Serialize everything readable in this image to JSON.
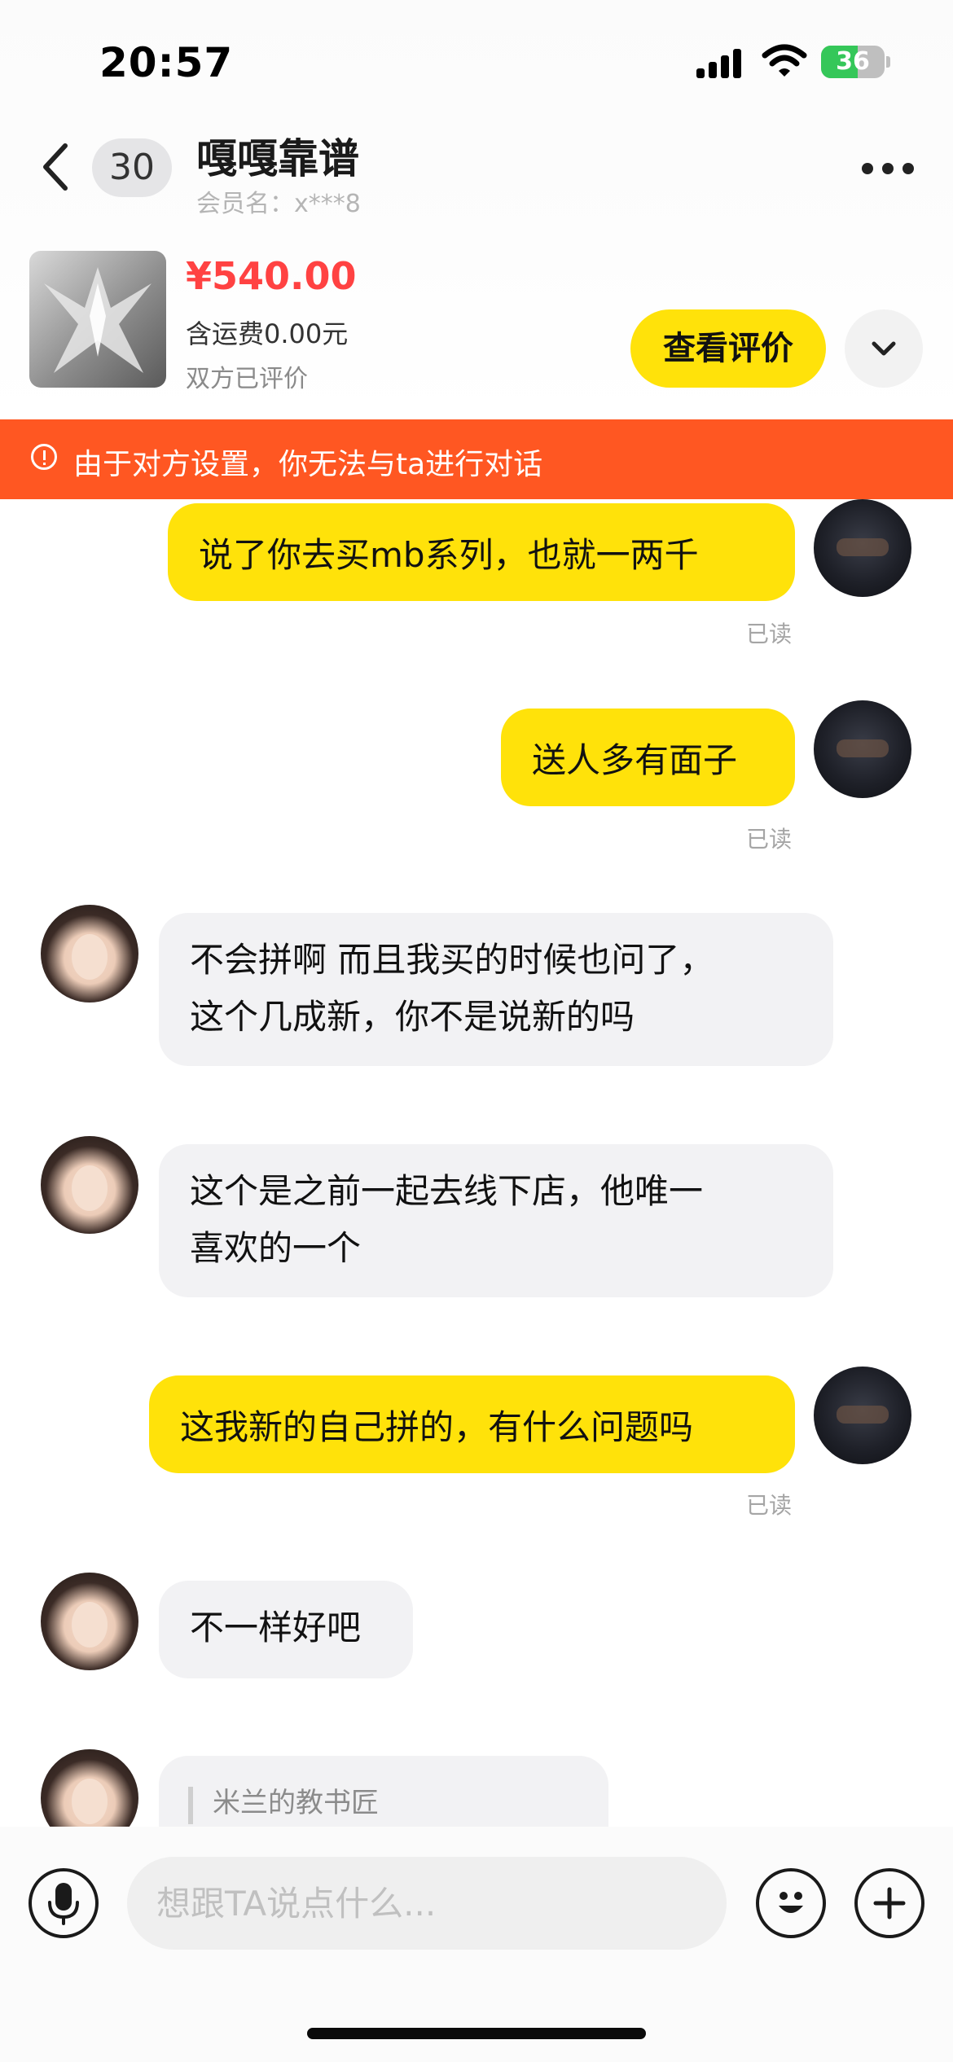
{
  "status_bar": {
    "time": "20:57",
    "battery": "36"
  },
  "header": {
    "unread_count": "30",
    "contact_name": "嘎嘎靠谱",
    "member_name": "会员名：x***8"
  },
  "product": {
    "price": "¥540.00",
    "shipping": "含运费0.00元",
    "review_status": "双方已评价",
    "review_button_label": "查看评价"
  },
  "warning": {
    "text": "由于对方设置，你无法与ta进行对话"
  },
  "messages": [
    {
      "text": "说了你去买mb系列，也就一两千",
      "status": "已读"
    },
    {
      "text": "送人多有面子",
      "status": "已读"
    },
    {
      "lines": [
        "不会拼啊 而且我买的时候也问了，",
        "这个几成新，你不是说新的吗"
      ]
    },
    {
      "lines": [
        "这个是之前一起去线下店，他唯一",
        "喜欢的一个"
      ]
    },
    {
      "text": "这我新的自己拼的，有什么问题吗",
      "status": "已读"
    },
    {
      "text": "不一样好吧"
    },
    {
      "quote": "米兰的教书匠"
    }
  ],
  "input": {
    "placeholder": "想跟TA说点什么..."
  },
  "colors": {
    "accent": "#ffe20a",
    "price": "#ff4242",
    "warning": "#ff5722"
  }
}
